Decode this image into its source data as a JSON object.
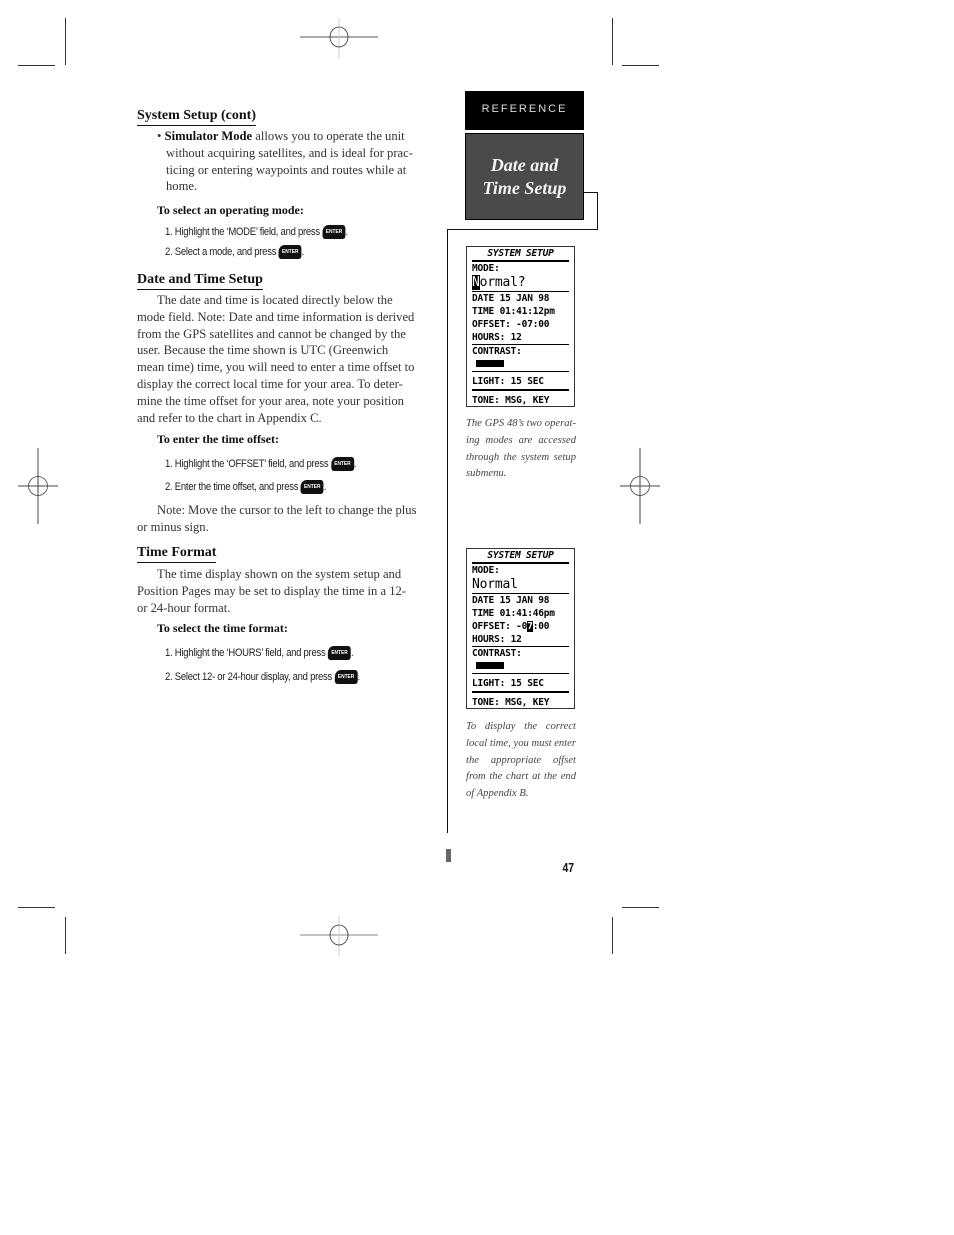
{
  "sidebar": {
    "tab_label": "REFERENCE",
    "section_title": "Date and Time Setup"
  },
  "sections": {
    "system_setup": {
      "heading": "System Setup (cont)",
      "bullet_marker": "•",
      "bullet_bold": "Simulator Mode",
      "bullet_text_1": " allows you to operate the unit",
      "bullet_text_2": "without acquiring satellites, and is ideal for prac-",
      "bullet_text_3": "ticing or entering waypoints and routes while at",
      "bullet_text_4": "home.",
      "procedure_title": "To select an operating mode:",
      "steps": [
        "1. Highlight the ‘MODE’ field, and press",
        "2. Select a mode, and press"
      ]
    },
    "date_time": {
      "heading": "Date and Time Setup",
      "lines": [
        "The date and time is located directly below the",
        "mode field.  Note: Date and time information is derived",
        "from the GPS satellites and cannot be changed by the",
        "user.  Because the time shown is UTC (Greenwich",
        "mean time) time, you will need to enter a time offset to",
        "display the correct local time for your area.  To deter-",
        "mine the time offset for your area, note your position",
        "and refer to the chart in Appendix C."
      ],
      "procedure_title": "To enter the time offset:",
      "steps": [
        "1. Highlight the ‘OFFSET’ field, and press",
        "2. Enter the time offset, and press"
      ],
      "note_lines": [
        "Note: Move the cursor to the left to change the plus",
        "or minus sign."
      ]
    },
    "time_format": {
      "heading": "Time Format",
      "lines": [
        "The time display shown on the system setup and",
        "Position Pages may be set to display the time in a 12-",
        "or 24-hour format."
      ],
      "procedure_title": "To select the time format:",
      "steps": [
        "1. Highlight the ‘HOURS’ field, and press",
        "2. Select 12- or 24-hour display, and press"
      ]
    }
  },
  "enter_key_label": "ENTER",
  "screens": [
    {
      "header": "SYSTEM SETUP",
      "mode_label": "MODE:",
      "mode_cursor": "N",
      "mode_value": "ormal?",
      "date": "DATE  15 JAN 98",
      "time": "TIME 01:41:12pm",
      "offset_prefix": "OFFSET: -07:00",
      "offset_cursor": "",
      "offset_suffix": "",
      "hours": "HOURS:  12",
      "contrast": "CONTRAST:",
      "light": "LIGHT: 15 SEC",
      "tone": "TONE: MSG, KEY"
    },
    {
      "header": "SYSTEM SETUP",
      "mode_label": "MODE:",
      "mode_cursor": "",
      "mode_value": "Normal",
      "date": "DATE  15 JAN 98",
      "time": "TIME 01:41:46pm",
      "offset_prefix": "OFFSET: -0",
      "offset_cursor": "7",
      "offset_suffix": ":00",
      "hours": "HOURS:  12",
      "contrast": "CONTRAST:",
      "light": "LIGHT: 15 SEC",
      "tone": "TONE: MSG, KEY"
    }
  ],
  "captions": [
    "The GPS 48’s two operat-ing modes are accessed through the system setup submenu.",
    "To display the correct local time, you must enter the appropriate offset from the chart at the end of Appendix B."
  ],
  "page_number": "47"
}
